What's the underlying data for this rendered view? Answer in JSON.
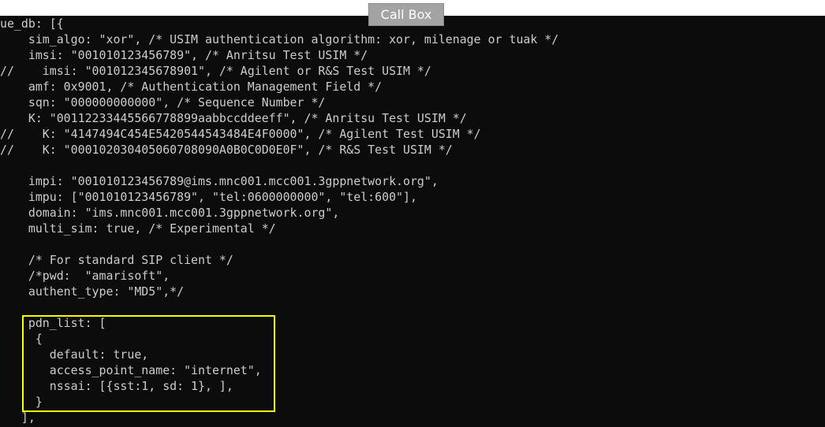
{
  "toolbar": {
    "call_box_label": "Call Box"
  },
  "colors": {
    "console_bg": "#0c0c0c",
    "console_text": "#cccccc",
    "highlight_border": "#ffff00",
    "button_bg": "#a3a3a3"
  },
  "code_lines": [
    "ue_db: [{",
    "    sim_algo: \"xor\", /* USIM authentication algorithm: xor, milenage or tuak */",
    "    imsi: \"001010123456789\", /* Anritsu Test USIM */",
    "//    imsi: \"001012345678901\", /* Agilent or R&S Test USIM */",
    "    amf: 0x9001, /* Authentication Management Field */",
    "    sqn: \"000000000000\", /* Sequence Number */",
    "    K: \"00112233445566778899aabbccddeeff\", /* Anritsu Test USIM */",
    "//    K: \"4147494C454E5420544543484E4F0000\", /* Agilent Test USIM */",
    "//    K: \"000102030405060708090A0B0C0D0E0F\", /* R&S Test USIM */",
    "",
    "    impi: \"001010123456789@ims.mnc001.mcc001.3gppnetwork.org\",",
    "    impu: [\"001010123456789\", \"tel:0600000000\", \"tel:600\"],",
    "    domain: \"ims.mnc001.mcc001.3gppnetwork.org\",",
    "    multi_sim: true, /* Experimental */",
    "",
    "    /* For standard SIP client */",
    "    /*pwd:  \"amarisoft\",",
    "    authent_type: \"MD5\",*/",
    "",
    "    pdn_list: [",
    "     {",
    "       default: true,",
    "       access_point_name: \"internet\",",
    "       nssai: [{sst:1, sd: 1}, ],",
    "     }",
    "   ],"
  ],
  "highlight": {
    "label": "pdn_list block",
    "from_line": 19,
    "to_line": 24
  }
}
